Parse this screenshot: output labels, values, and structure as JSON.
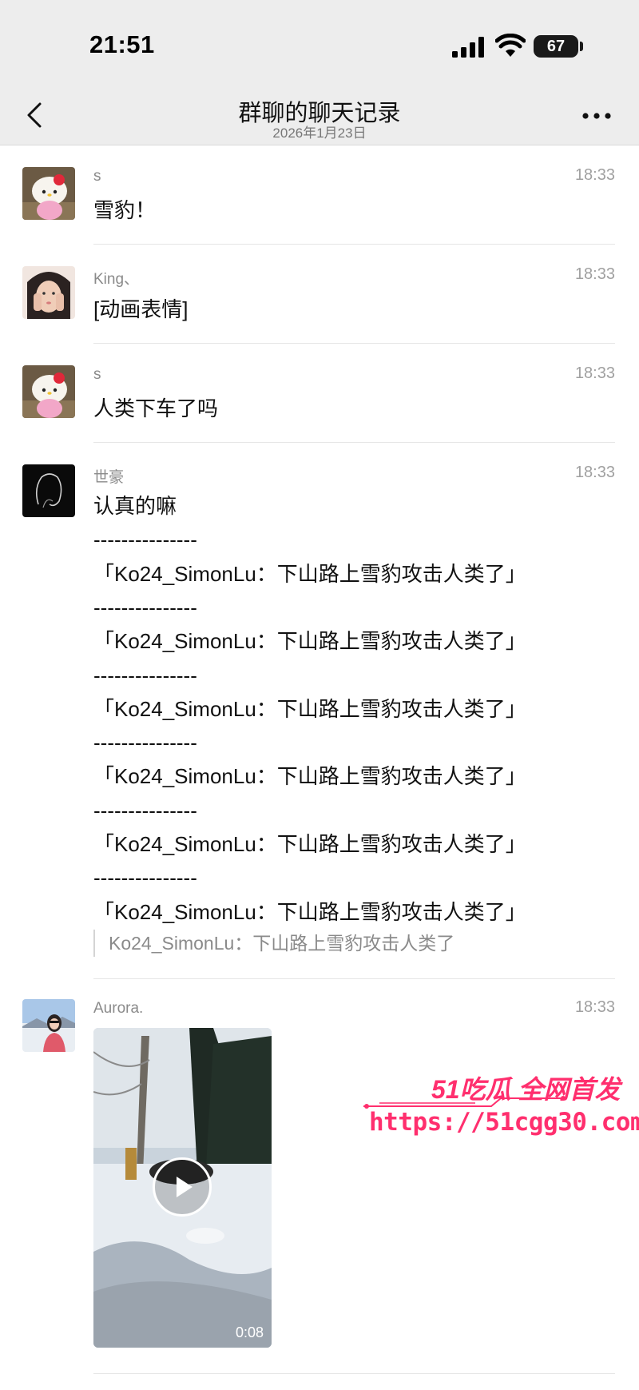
{
  "status_bar": {
    "time": "21:51",
    "battery": "67"
  },
  "nav": {
    "title": "群聊的聊天记录",
    "subtitle": "2026年1月23日"
  },
  "messages": [
    {
      "sender": "s",
      "time": "18:33",
      "text": "雪豹！",
      "avatar": "hello-kitty-plush"
    },
    {
      "sender": "King、",
      "time": "18:33",
      "text": "[动画表情]",
      "avatar": "girl-portrait"
    },
    {
      "sender": "s",
      "time": "18:33",
      "text": "人类下车了吗",
      "avatar": "hello-kitty-plush"
    },
    {
      "sender": "世豪",
      "time": "18:33",
      "avatar": "dark-silhouette",
      "lines": [
        "认真的嘛",
        "---------------",
        "「Ko24_SimonLu：下山路上雪豹攻击人类了」",
        "---------------",
        "「Ko24_SimonLu：下山路上雪豹攻击人类了」",
        "---------------",
        "「Ko24_SimonLu：下山路上雪豹攻击人类了」",
        "---------------",
        "「Ko24_SimonLu：下山路上雪豹攻击人类了」",
        "---------------",
        "「Ko24_SimonLu：下山路上雪豹攻击人类了」",
        "---------------",
        "「Ko24_SimonLu：下山路上雪豹攻击人类了」"
      ],
      "quote": "Ko24_SimonLu：下山路上雪豹攻击人类了"
    },
    {
      "sender": "Aurora.",
      "time": "18:33",
      "avatar": "girl-snow-photo",
      "video_duration": "0:08"
    }
  ],
  "watermark": {
    "brand": "51吃瓜 全网首发",
    "url": "https://51cgg30.com"
  },
  "colors": {
    "header_bg": "#ededed",
    "watermark": "#ff2f6e"
  },
  "icons": [
    "back-icon",
    "more-icon",
    "signal-icon",
    "wifi-icon",
    "play-icon"
  ]
}
